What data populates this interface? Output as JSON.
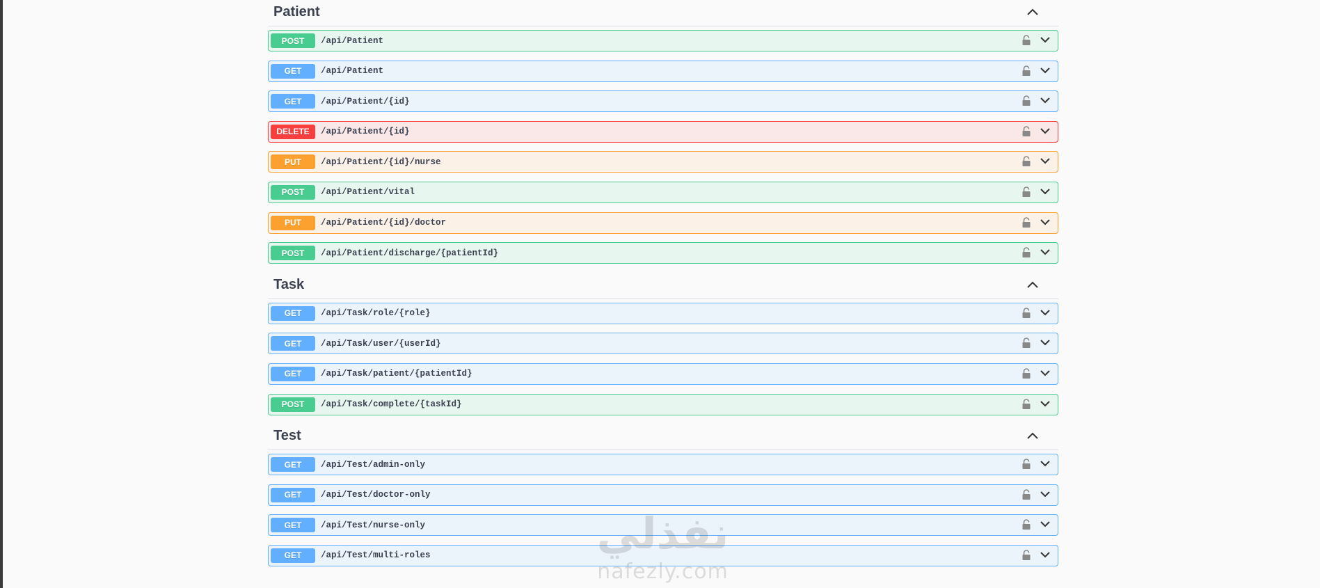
{
  "sections": [
    {
      "title": "Patient",
      "operations": [
        {
          "method": "POST",
          "path": "/api/Patient"
        },
        {
          "method": "GET",
          "path": "/api/Patient"
        },
        {
          "method": "GET",
          "path": "/api/Patient/{id}"
        },
        {
          "method": "DELETE",
          "path": "/api/Patient/{id}"
        },
        {
          "method": "PUT",
          "path": "/api/Patient/{id}/nurse"
        },
        {
          "method": "POST",
          "path": "/api/Patient/vital"
        },
        {
          "method": "PUT",
          "path": "/api/Patient/{id}/doctor"
        },
        {
          "method": "POST",
          "path": "/api/Patient/discharge/{patientId}"
        }
      ]
    },
    {
      "title": "Task",
      "operations": [
        {
          "method": "GET",
          "path": "/api/Task/role/{role}"
        },
        {
          "method": "GET",
          "path": "/api/Task/user/{userId}"
        },
        {
          "method": "GET",
          "path": "/api/Task/patient/{patientId}"
        },
        {
          "method": "POST",
          "path": "/api/Task/complete/{taskId}"
        }
      ]
    },
    {
      "title": "Test",
      "operations": [
        {
          "method": "GET",
          "path": "/api/Test/admin-only"
        },
        {
          "method": "GET",
          "path": "/api/Test/doctor-only"
        },
        {
          "method": "GET",
          "path": "/api/Test/nurse-only"
        },
        {
          "method": "GET",
          "path": "/api/Test/multi-roles"
        }
      ]
    }
  ],
  "colors": {
    "post": "#49cc90",
    "get": "#61affe",
    "delete": "#f93e3e",
    "put": "#fca130"
  },
  "watermark": {
    "arabic": "نفذلي",
    "latin": "nafezly.com"
  }
}
